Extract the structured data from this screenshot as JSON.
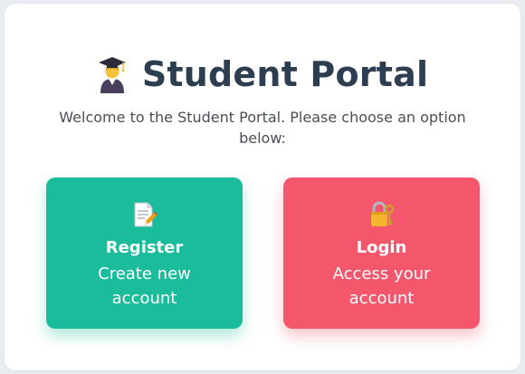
{
  "header": {
    "icon": "student-graduation-cap-icon",
    "title": "Student Portal",
    "subtitle": "Welcome to the Student Portal. Please choose an option below:"
  },
  "options": [
    {
      "icon": "memo-pencil-icon",
      "title": "Register",
      "description": "Create new account",
      "color": "#1abc9c"
    },
    {
      "icon": "lock-with-key-icon",
      "title": "Login",
      "description": "Access your account",
      "color": "#f4566c"
    }
  ],
  "colors": {
    "title": "#2c3e50",
    "background": "#e9edf2",
    "card": "#ffffff"
  }
}
